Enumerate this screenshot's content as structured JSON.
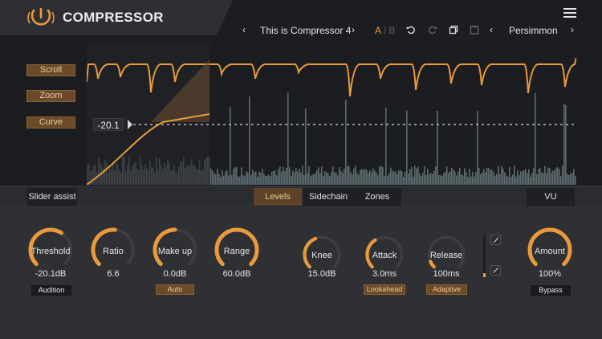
{
  "header": {
    "title": "COMPRESSOR",
    "preset_name": "This is Compressor 4",
    "ab_a": "A",
    "ab_sep": "/",
    "ab_b": "B",
    "theme_name": "Persimmon",
    "accent_color": "#e89a3c"
  },
  "side_buttons": {
    "scroll": "Scroll",
    "zoom": "Zoom",
    "curve": "Curve"
  },
  "visual": {
    "threshold_readout": "-20.1"
  },
  "tabs": {
    "slider_assist": "Slider assist",
    "levels": "Levels",
    "sidechain": "Sidechain",
    "zones": "Zones",
    "vu": "VU",
    "active": "Levels"
  },
  "knobs": [
    {
      "label": "Threshold",
      "value": "-20.1dB",
      "level": 0.62,
      "chip": "Audition",
      "chip_style": "dark"
    },
    {
      "label": "Ratio",
      "value": "6.6",
      "level": 0.52,
      "chip": "",
      "chip_style": ""
    },
    {
      "label": "Make up",
      "value": "0.0dB",
      "level": 0.5,
      "chip": "Auto",
      "chip_style": "orange"
    },
    {
      "label": "Range",
      "value": "60.0dB",
      "level": 1.0,
      "chip": "",
      "chip_style": ""
    },
    {
      "label": "Knee",
      "value": "15.0dB",
      "level": 0.42,
      "chip": "",
      "chip_style": ""
    },
    {
      "label": "Attack",
      "value": "3.0ms",
      "level": 0.38,
      "chip": "Lookahead",
      "chip_style": "orange"
    },
    {
      "label": "Release",
      "value": "100ms",
      "level": 0.08,
      "chip": "Adaptive",
      "chip_style": "orange"
    },
    {
      "label": "Amount",
      "value": "100%",
      "level": 1.0,
      "chip": "Bypass",
      "chip_style": "dark"
    }
  ]
}
